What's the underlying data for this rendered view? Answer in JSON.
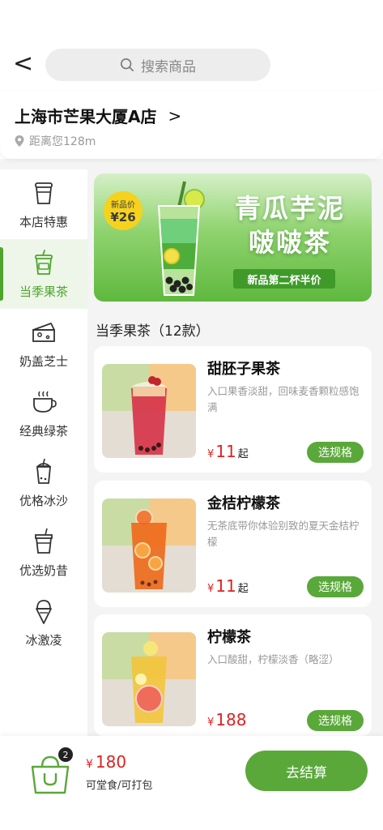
{
  "header": {
    "back_label": "<",
    "search_placeholder": "搜索商品",
    "store_name": "上海市芒果大厦A店",
    "store_chevron": ">",
    "distance": "距离您128m"
  },
  "sidebar": {
    "items": [
      {
        "label": "本店特惠",
        "icon": "cup-lid-icon",
        "active": false
      },
      {
        "label": "当季果茶",
        "icon": "fruit-tea-cup-icon",
        "active": true
      },
      {
        "label": "奶盖芝士",
        "icon": "cheese-icon",
        "active": false
      },
      {
        "label": "经典绿茶",
        "icon": "tea-mug-icon",
        "active": false
      },
      {
        "label": "优格冰沙",
        "icon": "smoothie-cup-icon",
        "active": false
      },
      {
        "label": "优选奶昔",
        "icon": "milkshake-cup-icon",
        "active": false
      },
      {
        "label": "冰激凌",
        "icon": "ice-cream-icon",
        "active": false
      }
    ]
  },
  "banner": {
    "badge_label": "新品价",
    "badge_price": "¥26",
    "title_line1": "青瓜芋泥",
    "title_line2": "啵啵茶",
    "subtitle": "新品第二杯半价"
  },
  "section": {
    "title": "当季果茶（12款）"
  },
  "products": [
    {
      "name": "甜胚子果茶",
      "desc": "入口果香淡甜，回味麦香颗粒感饱满",
      "currency": "¥",
      "price": "11",
      "suffix": "起",
      "button": "选规格",
      "drink_color": "#d7344a"
    },
    {
      "name": "金桔柠檬茶",
      "desc": "无茶底带你体验别致的夏天金桔柠檬",
      "currency": "¥",
      "price": "11",
      "suffix": "起",
      "button": "选规格",
      "drink_color": "#ee6a1c"
    },
    {
      "name": "柠檬茶",
      "desc": "入口酸甜，柠檬淡香（略涩）",
      "currency": "¥",
      "price": "188",
      "suffix": "",
      "button": "选规格",
      "drink_color": "#f2c53a"
    }
  ],
  "cart": {
    "count": "2",
    "currency": "¥",
    "total": "180",
    "dine_option": "可堂食/可打包",
    "checkout_label": "去结算"
  },
  "colors": {
    "accent": "#5aa83a",
    "price": "#dd2222"
  }
}
